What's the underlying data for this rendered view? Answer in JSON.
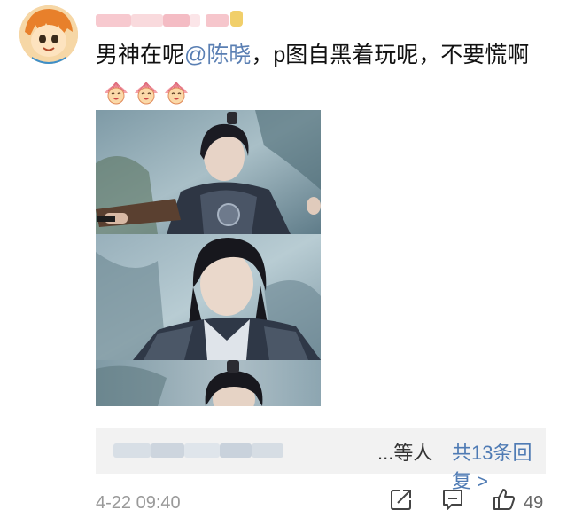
{
  "comment": {
    "text_prefix": "男神在呢",
    "mention": "@陈晓",
    "text_suffix": "，p图自黑着玩呢，不要慌啊",
    "emoji_icons": [
      "laughing-fan-emoji",
      "laughing-fan-emoji",
      "laughing-fan-emoji"
    ]
  },
  "replies": {
    "suffix": "...等人",
    "count_label": "共13条回复 >"
  },
  "footer": {
    "timestamp": "4-22 09:40",
    "like_count": "49",
    "icons": [
      "share-icon",
      "comment-icon",
      "like-icon"
    ]
  },
  "colors": {
    "mention": "#5a7fb3",
    "link": "#4f7bb4",
    "reply_bg": "#f2f2f2",
    "meta_text": "#999999"
  }
}
